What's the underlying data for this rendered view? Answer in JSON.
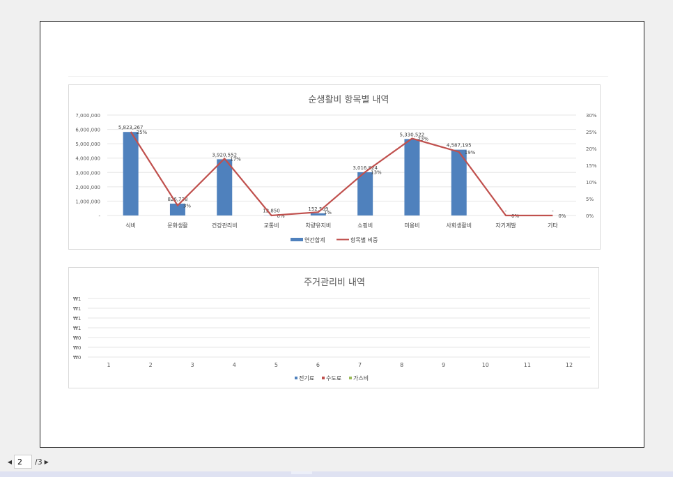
{
  "pager": {
    "current_page": "2",
    "total_label": "/3",
    "prev_icon": "triangle-left",
    "next_icon": "triangle-right"
  },
  "chart_data": [
    {
      "type": "bar",
      "title": "순생활비 항목별 내역",
      "categories": [
        "식비",
        "문화생활",
        "건강관리비",
        "교통비",
        "차량유지비",
        "쇼핑비",
        "미용비",
        "사회생활비",
        "자기계발",
        "기타"
      ],
      "series": [
        {
          "name": "연간합계",
          "type": "bar",
          "axis": "left",
          "color": "#4f81bd",
          "values": [
            5823267,
            826738,
            3920552,
            12850,
            152509,
            3016824,
            5330522,
            4587195,
            0,
            0
          ],
          "labels": [
            "5,823,267",
            "826,738",
            "3,920,552",
            "12,850",
            "152,509",
            "3,016,824",
            "5,330,522",
            "4,587,195",
            "-",
            "-"
          ]
        },
        {
          "name": "항목별 비중",
          "type": "line",
          "axis": "right",
          "color": "#c0504d",
          "values": [
            0.25,
            0.03,
            0.17,
            0.0,
            0.01,
            0.13,
            0.23,
            0.19,
            0.0,
            0.0
          ],
          "labels": [
            "25%",
            "3%",
            "17%",
            "0%",
            "1%",
            "13%",
            "23%",
            "19%",
            "0%",
            "0%"
          ]
        }
      ],
      "y_left": {
        "ylim": [
          0,
          7000000
        ],
        "ticks": [
          "-",
          "1,000,000",
          "2,000,000",
          "3,000,000",
          "4,000,000",
          "5,000,000",
          "6,000,000",
          "7,000,000"
        ]
      },
      "y_right": {
        "ylim": [
          0,
          0.3
        ],
        "ticks": [
          "0%",
          "5%",
          "10%",
          "15%",
          "20%",
          "25%",
          "30%"
        ]
      },
      "grid": true,
      "legend_position": "bottom"
    },
    {
      "type": "bar",
      "title": "주거관리비 내역",
      "categories": [
        "1",
        "2",
        "3",
        "4",
        "5",
        "6",
        "7",
        "8",
        "9",
        "10",
        "11",
        "12"
      ],
      "series": [
        {
          "name": "전기료",
          "color": "#4f81bd",
          "values": []
        },
        {
          "name": "수도료",
          "color": "#c0504d",
          "values": []
        },
        {
          "name": "가스비",
          "color": "#9bbb59",
          "values": []
        }
      ],
      "y_ticks": [
        "₩1",
        "₩1",
        "₩1",
        "₩1",
        "₩0",
        "₩0",
        "₩0"
      ],
      "grid": true,
      "legend_position": "bottom"
    }
  ]
}
